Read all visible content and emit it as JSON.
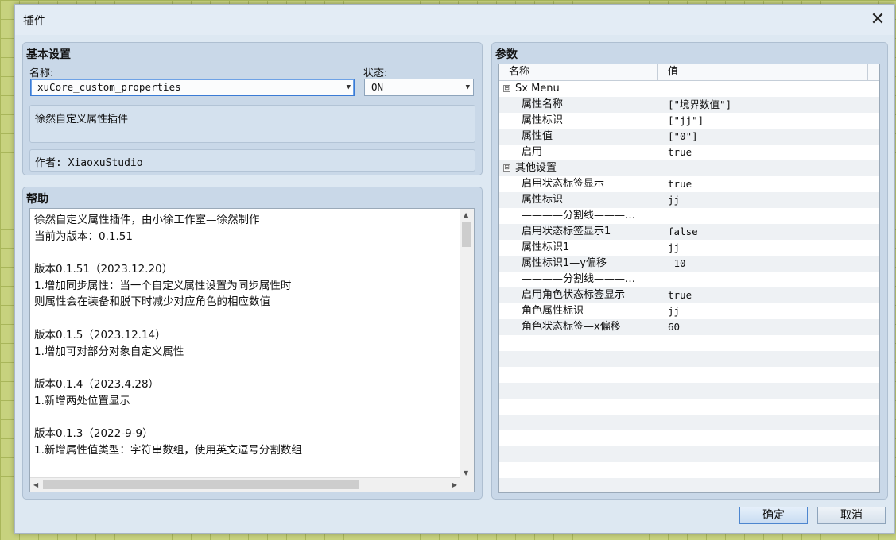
{
  "window": {
    "title": "插件",
    "close_glyph": "✕"
  },
  "basic": {
    "title": "基本设置",
    "name_label": "名称:",
    "name_value": "xuCore_custom_properties",
    "status_label": "状态:",
    "status_value": "ON",
    "description": "徐然自定义属性插件",
    "author": "作者: XiaoxuStudio"
  },
  "help": {
    "title": "帮助",
    "lines": [
      "徐然自定义属性插件，由小徐工作室—徐然制作",
      "当前为版本：0.1.51",
      "",
      "版本0.1.51（2023.12.20）",
      "1.增加同步属性：当一个自定义属性设置为同步属性时",
      "则属性会在装备和脱下时减少对应角色的相应数值",
      "",
      "版本0.1.5（2023.12.14）",
      "1.增加可对部分对象自定义属性",
      "",
      "版本0.1.4（2023.4.28）",
      "1.新增两处位置显示",
      "",
      "版本0.1.3（2022-9-9）",
      "1.新增属性值类型：字符串数组，使用英文逗号分割数组",
      ""
    ]
  },
  "params": {
    "title": "参数",
    "col_name": "名称",
    "col_value": "值",
    "rows": [
      {
        "name": "Sx Menu",
        "value": "",
        "group": true,
        "expand": "⊟"
      },
      {
        "name": "属性名称",
        "value": "[\"境界数值\"]"
      },
      {
        "name": "属性标识",
        "value": "[\"jj\"]"
      },
      {
        "name": "属性值",
        "value": "[\"0\"]"
      },
      {
        "name": "启用",
        "value": "true"
      },
      {
        "name": "其他设置",
        "value": "",
        "group": true,
        "expand": "⊟"
      },
      {
        "name": "启用状态标签显示",
        "value": "true"
      },
      {
        "name": "属性标识",
        "value": "jj"
      },
      {
        "name": "————分割线———…",
        "value": ""
      },
      {
        "name": "启用状态标签显示1",
        "value": "false"
      },
      {
        "name": "属性标识1",
        "value": "jj"
      },
      {
        "name": "属性标识1—y偏移",
        "value": "-10"
      },
      {
        "name": "————分割线———…",
        "value": ""
      },
      {
        "name": "启用角色状态标签显示",
        "value": "true"
      },
      {
        "name": "角色属性标识",
        "value": "jj"
      },
      {
        "name": "角色状态标签—x偏移",
        "value": "60"
      }
    ],
    "total_rows": 27
  },
  "buttons": {
    "ok": "确定",
    "cancel": "取消"
  },
  "icons": {
    "dropdown": "chevron-down-icon",
    "close": "close-icon",
    "expand": "minus-box-icon"
  }
}
